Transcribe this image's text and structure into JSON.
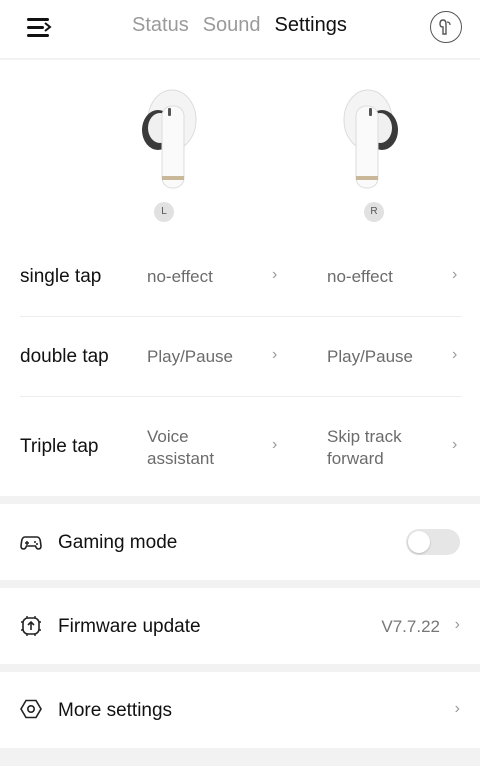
{
  "header": {
    "tabs": [
      {
        "label": "Status"
      },
      {
        "label": "Sound"
      },
      {
        "label": "Settings"
      }
    ]
  },
  "earbuds": {
    "left_label": "L",
    "right_label": "R"
  },
  "controls": [
    {
      "label": "single tap",
      "left": "no-effect",
      "right": "no-effect"
    },
    {
      "label": "double tap",
      "left": "Play/Pause",
      "right": "Play/Pause"
    },
    {
      "label": "Triple tap",
      "left_line1": "Voice",
      "left_line2": "assistant",
      "right_line1": "Skip track",
      "right_line2": "forward"
    }
  ],
  "gaming": {
    "label": "Gaming mode",
    "enabled": false
  },
  "firmware": {
    "label": "Firmware update",
    "version": "V7.7.22"
  },
  "more": {
    "label": "More settings"
  },
  "icons": [
    "menu-icon",
    "earbud-icon",
    "gamepad-icon",
    "firmware-icon",
    "hexagon-settings-icon",
    "chevron-right-icon"
  ],
  "colors": {
    "active_tab": "#111111",
    "inactive_tab": "#9a9a9a",
    "background": "#f2f2f2"
  }
}
